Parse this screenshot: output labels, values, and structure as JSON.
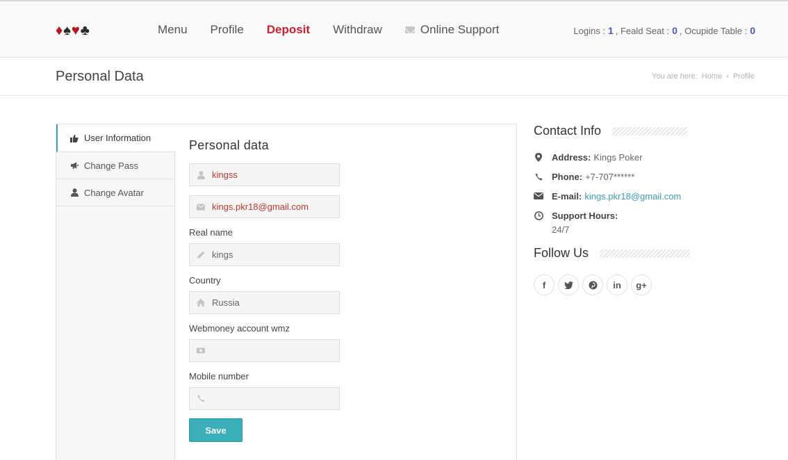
{
  "header": {
    "suits": [
      "♦",
      "♠",
      "♥",
      "♣"
    ],
    "nav": [
      {
        "label": "Menu",
        "active": false
      },
      {
        "label": "Profile",
        "active": false
      },
      {
        "label": "Deposit",
        "active": true
      },
      {
        "label": "Withdraw",
        "active": false
      },
      {
        "label": "Online Support",
        "active": false,
        "icon": "envelope-icon"
      }
    ],
    "stats": {
      "logins_label": "Logins :",
      "logins_value": "1",
      "feald_label": ", Feald Seat :",
      "feald_value": "0",
      "table_label": ", Ocupide Table :",
      "table_value": "0"
    }
  },
  "titlebar": {
    "title": "Personal Data",
    "breadcrumb_prefix": "You are here:",
    "breadcrumb_home": "Home",
    "breadcrumb_sep": "›",
    "breadcrumb_current": "Profile"
  },
  "sidebar": {
    "tabs": [
      {
        "label": "User Information",
        "icon": "thumbs-up-icon",
        "active": true
      },
      {
        "label": "Change Pass",
        "icon": "megaphone-icon",
        "active": false
      },
      {
        "label": "Change Avatar",
        "icon": "user-icon",
        "active": false
      }
    ]
  },
  "form": {
    "title": "Personal data",
    "username": {
      "value": "kingss",
      "icon": "user-icon"
    },
    "email": {
      "value": "kings.pkr18@gmail.com",
      "icon": "envelope-icon"
    },
    "real_name": {
      "label": "Real name",
      "value": "kings",
      "icon": "pencil-icon"
    },
    "country": {
      "label": "Country",
      "value": "Russia",
      "icon": "home-icon"
    },
    "webmoney": {
      "label": "Webmoney account wmz",
      "value": "",
      "icon": "money-icon"
    },
    "mobile": {
      "label": "Mobile number",
      "value": "",
      "icon": "phone-icon"
    },
    "save_label": "Save"
  },
  "contact": {
    "heading": "Contact Info",
    "address_label": "Address:",
    "address_value": "Kings Poker",
    "phone_label": "Phone:",
    "phone_value": "+7-707******",
    "email_label": "E-mail:",
    "email_value": "kings.pkr18@gmail.com",
    "hours_label": "Support Hours:",
    "hours_value": "24/7"
  },
  "follow": {
    "heading": "Follow Us",
    "networks": [
      {
        "glyph": "f",
        "name": "facebook"
      },
      {
        "glyph": "t",
        "name": "twitter"
      },
      {
        "glyph": "p",
        "name": "pinterest"
      },
      {
        "glyph": "in",
        "name": "linkedin"
      },
      {
        "glyph": "g+",
        "name": "google-plus"
      }
    ]
  },
  "colors": {
    "accent": "#3aaeb9",
    "nav_active": "#d0202b",
    "stat_number": "#4a54c8",
    "link": "#3a9db0",
    "input_value_red": "#c0392b"
  }
}
